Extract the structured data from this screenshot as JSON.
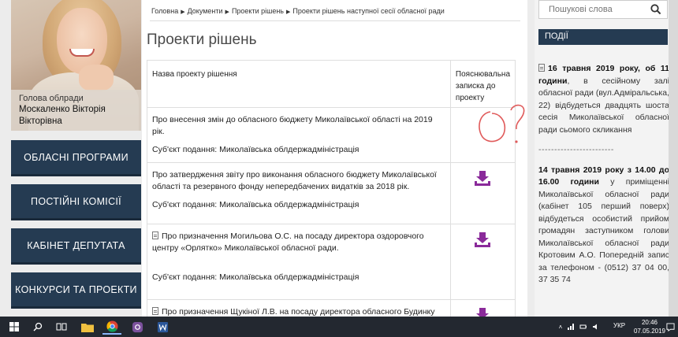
{
  "profile": {
    "role": "Голова облради",
    "name": "Москаленко Вікторія Вікторівна"
  },
  "nav": [
    {
      "label": "ОБЛАСНІ ПРОГРАМИ"
    },
    {
      "label": "ПОСТІЙНІ КОМІСІЇ"
    },
    {
      "label": "КАБІНЕТ ДЕПУТАТА"
    },
    {
      "label": "КОНКУРСИ ТА ПРОЕКТИ"
    }
  ],
  "breadcrumb": [
    "Головна",
    "Документи",
    "Проекти рішень",
    "Проекти рішень наступної сесії обласної ради"
  ],
  "page_title": "Проекти рішень",
  "table": {
    "headers": [
      "Назва проекту рішення",
      "Пояснювальна записка до проекту"
    ],
    "rows": [
      {
        "title": "Про внесення змін до обласного бюджету Миколаївської області на 2019 рік.",
        "submitter": "Суб'єкт подання: Миколаївська облдержадміністрація",
        "has_doc_icon": false,
        "has_download": false
      },
      {
        "title": "Про затвердження звіту про виконання обласного бюджету Миколаївської області та резервного фонду непередбачених видатків за 2018 рік.",
        "submitter": "Суб'єкт подання: Миколаївська облдержадміністрація",
        "has_doc_icon": false,
        "has_download": true
      },
      {
        "title": "Про призначення Могильова О.С. на посаду директора оздоровчого центру «Орлятко» Миколаївської обласної ради.",
        "submitter": "Суб'єкт подання: Миколаївська облдержадміністрація",
        "has_doc_icon": true,
        "has_download": true
      },
      {
        "title": "Про призначення Щукіної Л.В. на посаду директора обласного Будинку",
        "submitter": "",
        "has_doc_icon": true,
        "has_download": true
      }
    ]
  },
  "search": {
    "placeholder": "Пошукові слова"
  },
  "events": {
    "header": "ПОДІЇ",
    "item1_bold": "16 травня 2019 року, об 11 години",
    "item1_text": ", в сесійному залі обласної ради (вул.Адміральська, 22) відбудеться двадцять шоста сесія Миколаївської обласної ради сьомого скликання",
    "divider": "------------------------",
    "item2_bold": "14 травня 2019 року з 14.00 до 16.00 години",
    "item2_text": " у приміщенні Миколаївської обласної ради (кабінет 105 перший поверх) відбудеться особистий прийом громадян заступником голови Миколаївської обласної ради Кротовим А.О. Попередній запис за телефоном - (0512) 37 04 00, 37 35 74"
  },
  "taskbar": {
    "lang": "УКР",
    "time": "20:46",
    "date": "07.05.2019"
  },
  "colors": {
    "nav_bg": "#253b52",
    "download_icon": "#8a2a9a",
    "scribble": "#e05a5a"
  }
}
